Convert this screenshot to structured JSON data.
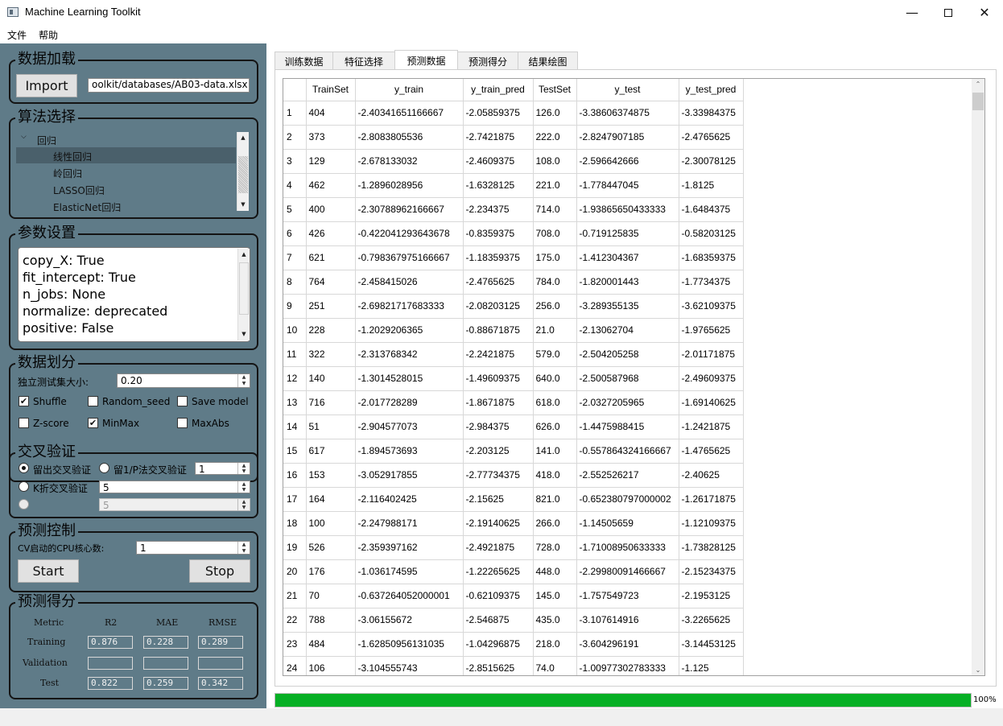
{
  "window": {
    "title": "Machine Learning Toolkit"
  },
  "menu": {
    "file": "文件",
    "help": "帮助"
  },
  "data_load": {
    "title": "数据加载",
    "import_label": "Import",
    "path": "oolkit/databases/AB03-data.xlsx"
  },
  "algorithm": {
    "title": "算法选择",
    "root": "回归",
    "items": [
      "线性回归",
      "岭回归",
      "LASSO回归",
      "ElasticNet回归"
    ],
    "selected_index": 0
  },
  "params": {
    "title": "参数设置",
    "lines": [
      "copy_X: True",
      "fit_intercept: True",
      "n_jobs: None",
      "normalize: deprecated",
      "positive: False"
    ]
  },
  "split": {
    "title": "数据划分",
    "test_size_label": "独立测试集大小:",
    "test_size_value": "0.20",
    "checks": [
      {
        "label": "Shuffle",
        "checked": true
      },
      {
        "label": "Random_seed",
        "checked": false
      },
      {
        "label": "Save model",
        "checked": false
      },
      {
        "label": "Z-score",
        "checked": false
      },
      {
        "label": "MinMax",
        "checked": true
      },
      {
        "label": "MaxAbs",
        "checked": false
      }
    ]
  },
  "cv": {
    "title": "交叉验证",
    "holdout_label": "留出交叉验证",
    "leave_p_label": "留1/P法交叉验证",
    "leave_p_value": "1",
    "kfold_label": "K折交叉验证",
    "kfold_value": "5",
    "third_value": "5"
  },
  "control": {
    "title": "预测控制",
    "cpu_label": "CV启动的CPU核心数:",
    "cpu_value": "1",
    "start_label": "Start",
    "stop_label": "Stop"
  },
  "score": {
    "title": "预测得分",
    "headers": [
      "Metric",
      "R2",
      "MAE",
      "RMSE"
    ],
    "rows": [
      {
        "name": "Training",
        "values": [
          "0.876",
          "0.228",
          "0.289"
        ]
      },
      {
        "name": "Validation",
        "values": [
          "",
          "",
          ""
        ]
      },
      {
        "name": "Test",
        "values": [
          "0.822",
          "0.259",
          "0.342"
        ]
      }
    ]
  },
  "tabs": [
    "训练数据",
    "特征选择",
    "预测数据",
    "预测得分",
    "结果绘图"
  ],
  "active_tab": 2,
  "table": {
    "headers": [
      "TrainSet",
      "y_train",
      "y_train_pred",
      "TestSet",
      "y_test",
      "y_test_pred"
    ],
    "rows": [
      [
        "404",
        "-2.40341651166667",
        "-2.05859375",
        "126.0",
        "-3.38606374875",
        "-3.33984375"
      ],
      [
        "373",
        "-2.8083805536",
        "-2.7421875",
        "222.0",
        "-2.8247907185",
        "-2.4765625"
      ],
      [
        "129",
        "-2.678133032",
        "-2.4609375",
        "108.0",
        "-2.596642666",
        "-2.30078125"
      ],
      [
        "462",
        "-1.2896028956",
        "-1.6328125",
        "221.0",
        "-1.778447045",
        "-1.8125"
      ],
      [
        "400",
        "-2.30788962166667",
        "-2.234375",
        "714.0",
        "-1.93865650433333",
        "-1.6484375"
      ],
      [
        "426",
        "-0.422041293643678",
        "-0.8359375",
        "708.0",
        "-0.719125835",
        "-0.58203125"
      ],
      [
        "621",
        "-0.798367975166667",
        "-1.18359375",
        "175.0",
        "-1.412304367",
        "-1.68359375"
      ],
      [
        "764",
        "-2.458415026",
        "-2.4765625",
        "784.0",
        "-1.820001443",
        "-1.7734375"
      ],
      [
        "251",
        "-2.69821717683333",
        "-2.08203125",
        "256.0",
        "-3.289355135",
        "-3.62109375"
      ],
      [
        "228",
        "-1.2029206365",
        "-0.88671875",
        "21.0",
        "-2.13062704",
        "-1.9765625"
      ],
      [
        "322",
        "-2.313768342",
        "-2.2421875",
        "579.0",
        "-2.504205258",
        "-2.01171875"
      ],
      [
        "140",
        "-1.3014528015",
        "-1.49609375",
        "640.0",
        "-2.500587968",
        "-2.49609375"
      ],
      [
        "716",
        "-2.017728289",
        "-1.8671875",
        "618.0",
        "-2.0327205965",
        "-1.69140625"
      ],
      [
        "51",
        "-2.904577073",
        "-2.984375",
        "626.0",
        "-1.4475988415",
        "-1.2421875"
      ],
      [
        "617",
        "-1.894573693",
        "-2.203125",
        "141.0",
        "-0.557864324166667",
        "-1.4765625"
      ],
      [
        "153",
        "-3.052917855",
        "-2.77734375",
        "418.0",
        "-2.552526217",
        "-2.40625"
      ],
      [
        "164",
        "-2.116402425",
        "-2.15625",
        "821.0",
        "-0.652380797000002",
        "-1.26171875"
      ],
      [
        "100",
        "-2.247988171",
        "-2.19140625",
        "266.0",
        "-1.14505659",
        "-1.12109375"
      ],
      [
        "526",
        "-2.359397162",
        "-2.4921875",
        "728.0",
        "-1.71008950633333",
        "-1.73828125"
      ],
      [
        "176",
        "-1.036174595",
        "-1.22265625",
        "448.0",
        "-2.29980091466667",
        "-2.15234375"
      ],
      [
        "70",
        "-0.637264052000001",
        "-0.62109375",
        "145.0",
        "-1.757549723",
        "-2.1953125"
      ],
      [
        "788",
        "-3.06155672",
        "-2.546875",
        "435.0",
        "-3.107614916",
        "-3.2265625"
      ],
      [
        "484",
        "-1.62850956131035",
        "-1.04296875",
        "218.0",
        "-3.604296191",
        "-3.14453125"
      ],
      [
        "106",
        "-3.104555743",
        "-2.8515625",
        "74.0",
        "-1.00977302783333",
        "-1.125"
      ]
    ]
  },
  "progress": {
    "value": 1.0,
    "text": "100%",
    "color": "#06b025"
  }
}
